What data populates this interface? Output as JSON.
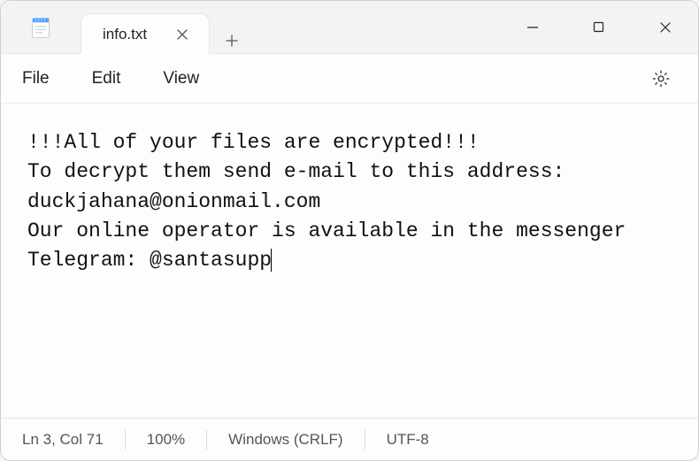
{
  "tab": {
    "title": "info.txt"
  },
  "menu": {
    "file": "File",
    "edit": "Edit",
    "view": "View"
  },
  "content": {
    "text": "!!!All of your files are encrypted!!!\nTo decrypt them send e-mail to this address: duckjahana@onionmail.com\nOur online operator is available in the messenger Telegram: @santasupp"
  },
  "status": {
    "position": "Ln 3, Col 71",
    "zoom": "100%",
    "line_ending": "Windows (CRLF)",
    "encoding": "UTF-8"
  }
}
